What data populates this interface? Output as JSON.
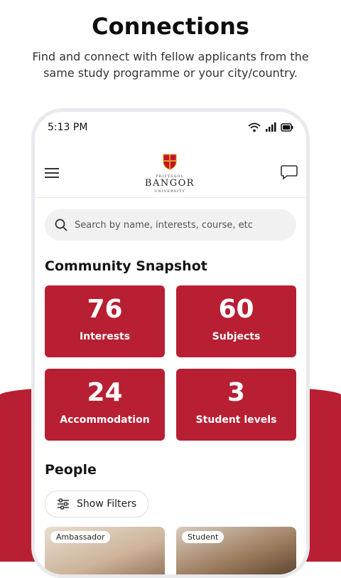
{
  "hero": {
    "title": "Connections",
    "subtitle": "Find and connect with fellow applicants from the same study programme or your city/country."
  },
  "status_bar": {
    "time": "5:13 PM"
  },
  "header": {
    "logo_top": "PRIFYSGOL",
    "logo_main": "BANGOR",
    "logo_bottom": "UNIVERSITY"
  },
  "search": {
    "placeholder": "Search by name, interests, course, etc"
  },
  "snapshot": {
    "title": "Community Snapshot",
    "cards": [
      {
        "value": "76",
        "label": "Interests"
      },
      {
        "value": "60",
        "label": "Subjects"
      },
      {
        "value": "24",
        "label": "Accommodation"
      },
      {
        "value": "3",
        "label": "Student levels"
      }
    ]
  },
  "people": {
    "title": "People",
    "filters_label": "Show Filters",
    "cards": [
      {
        "tag": "Ambassador"
      },
      {
        "tag": "Student"
      }
    ]
  },
  "colors": {
    "brand_red": "#b81f33"
  }
}
